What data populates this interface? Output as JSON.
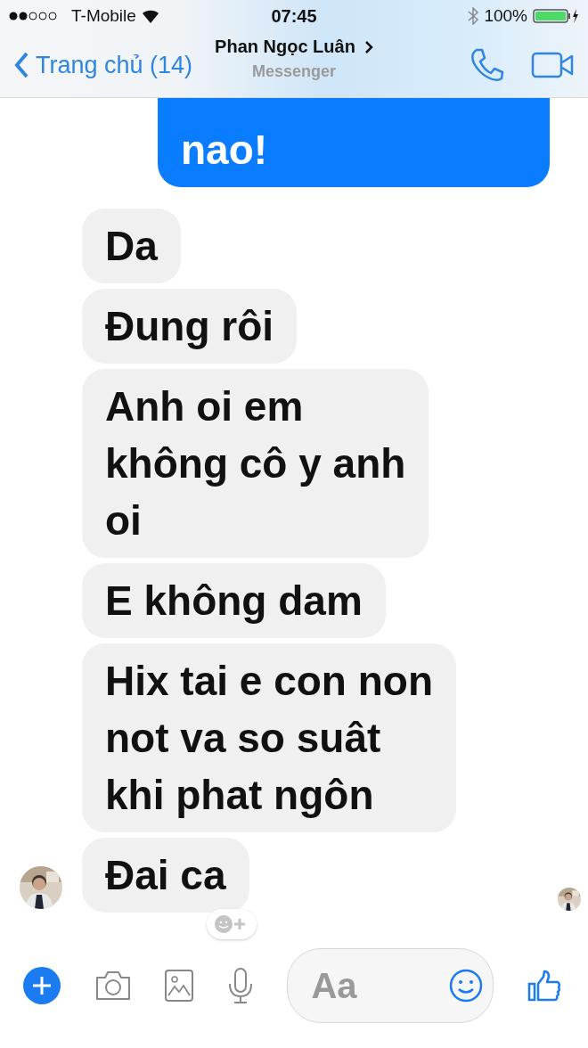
{
  "status_bar": {
    "carrier": "T-Mobile",
    "time": "07:45",
    "battery": "100%"
  },
  "header": {
    "back_label": "Trang chủ (14)",
    "title": "Phan Ngọc Luân",
    "subtitle": "Messenger"
  },
  "messages": [
    {
      "kind": "sent",
      "text": "nao!"
    },
    {
      "kind": "received",
      "text": "Da"
    },
    {
      "kind": "received",
      "text": "Đung rôi"
    },
    {
      "kind": "received",
      "text": "Anh oi em\nkhông cô y anh\noi"
    },
    {
      "kind": "received",
      "text": "E không dam"
    },
    {
      "kind": "received",
      "text": "Hix tai e con non\nnot va so suât\nkhi phat ngôn"
    },
    {
      "kind": "received",
      "text": "Đai ca"
    }
  ],
  "composer": {
    "placeholder": "Aa"
  }
}
